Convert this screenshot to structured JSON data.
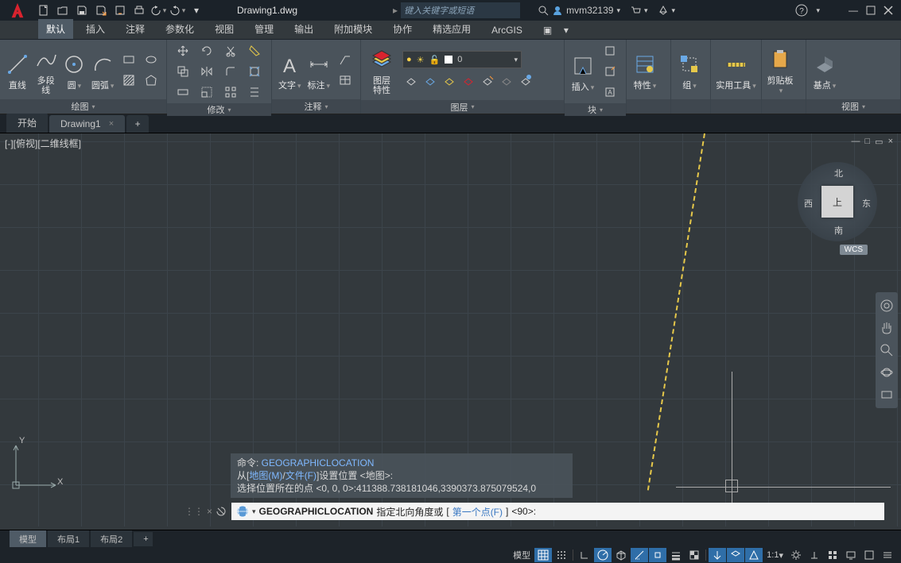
{
  "title": {
    "filename": "Drawing1.dwg",
    "search_placeholder": "键入关键字或短语",
    "username": "mvm32139"
  },
  "ribbon_tabs": [
    "默认",
    "插入",
    "注释",
    "参数化",
    "视图",
    "管理",
    "输出",
    "附加模块",
    "协作",
    "精选应用",
    "ArcGIS"
  ],
  "ribbon": {
    "draw": {
      "title": "绘图",
      "line": "直线",
      "pline": "多段线",
      "circle": "圆",
      "arc": "圆弧"
    },
    "modify": {
      "title": "修改"
    },
    "annot": {
      "title": "注释",
      "text": "文字",
      "dim": "标注"
    },
    "layers": {
      "title": "图层",
      "props": "图层\n特性",
      "current_layer": "0"
    },
    "block": {
      "title": "块",
      "insert": "插入"
    },
    "props": {
      "title": "特性",
      "btn": "特性"
    },
    "group": {
      "title": "组",
      "btn": "组"
    },
    "util": {
      "title": "",
      "btn": "实用工具"
    },
    "clip": {
      "title": "",
      "btn": "剪贴板"
    },
    "view": {
      "title": "视图",
      "btn": "基点"
    }
  },
  "drawing_tabs": {
    "start": "开始",
    "file": "Drawing1"
  },
  "viewport": {
    "label": "[-][俯视][二维线框]"
  },
  "viewcube": {
    "face": "上",
    "n": "北",
    "s": "南",
    "e": "东",
    "w": "西",
    "wcs": "WCS"
  },
  "ucs": {
    "x": "X",
    "y": "Y"
  },
  "command_history": {
    "line1_a": "命令: ",
    "line1_b": "GEOGRAPHICLOCATION",
    "line2_a": "从[",
    "line2_b": "地图(M)",
    "line2_c": "/",
    "line2_d": "文件(F)",
    "line2_e": "]设置位置 <地图>:",
    "line3": "选择位置所在的点 <0, 0, 0>:411388.738181046,3390373.875079524,0"
  },
  "command_line": {
    "cmd": "GEOGRAPHICLOCATION",
    "prompt1": " 指定北向角度或 ",
    "br1": "[",
    "opt": "第一个点(F)",
    "br2": "]",
    "default": " <90>:"
  },
  "layout_tabs": {
    "model": "模型",
    "l1": "布局1",
    "l2": "布局2"
  },
  "status": {
    "model": "模型",
    "scale": "1:1"
  }
}
